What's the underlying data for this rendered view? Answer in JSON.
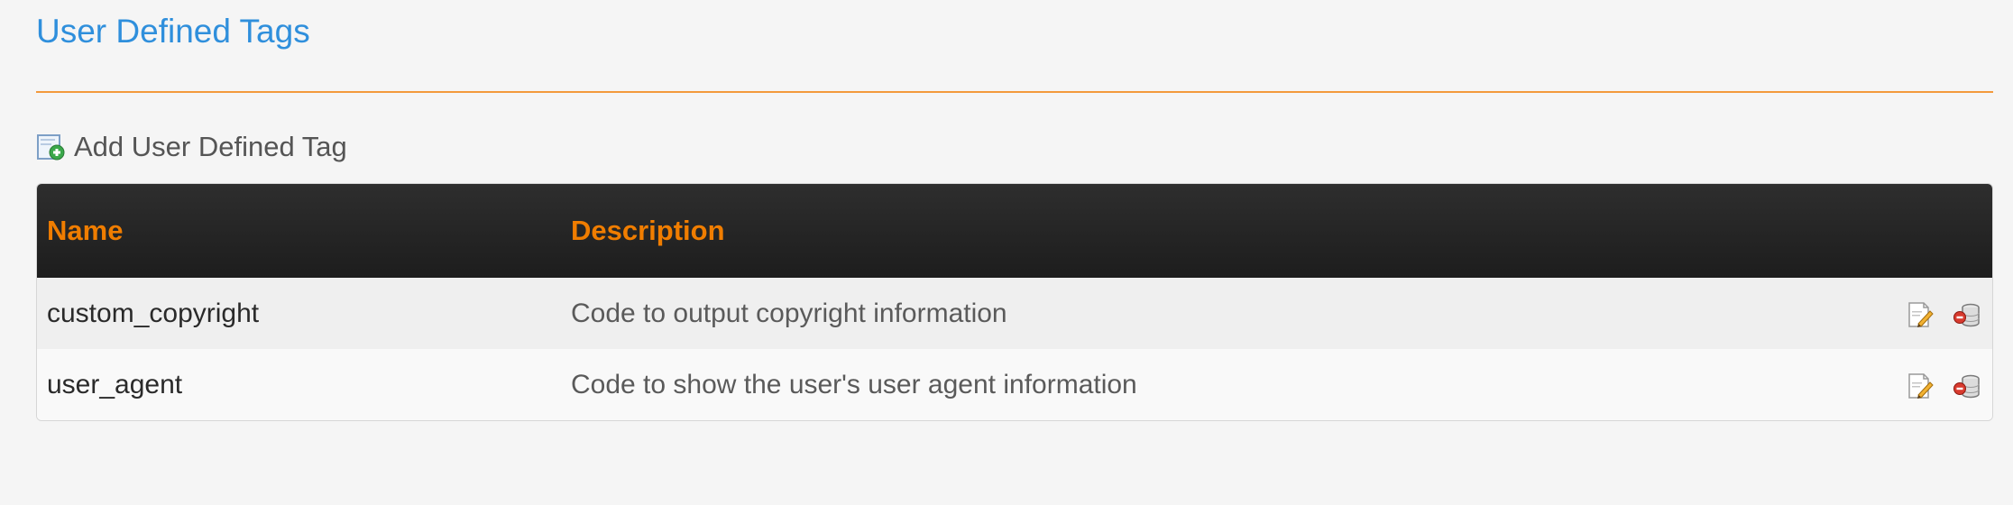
{
  "page": {
    "title": "User Defined Tags",
    "add_link_label": "Add User Defined Tag",
    "add_icon": "add-tag-icon"
  },
  "table": {
    "columns": [
      "Name",
      "Description",
      ""
    ],
    "rows": [
      {
        "name": "custom_copyright",
        "description": "Code to output copyright information",
        "actions": [
          "edit-icon",
          "delete-icon"
        ]
      },
      {
        "name": "user_agent",
        "description": "Code to show the user's user agent information",
        "actions": [
          "edit-icon",
          "delete-icon"
        ]
      }
    ]
  },
  "colors": {
    "title": "#2f8fdc",
    "rule": "#f39a3c",
    "header_text": "#f07d00",
    "header_bg": "#222222"
  }
}
